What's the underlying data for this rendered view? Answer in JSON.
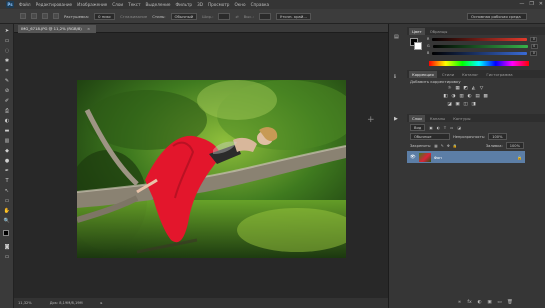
{
  "app": {
    "logo": "Ps"
  },
  "menu": {
    "items": [
      "Файл",
      "Редактирование",
      "Изображение",
      "Слои",
      "Текст",
      "Выделение",
      "Фильтр",
      "3D",
      "Просмотр",
      "Окно",
      "Справка"
    ]
  },
  "window_controls": {
    "minimize": "—",
    "restore": "❐",
    "close": "✕"
  },
  "options_bar": {
    "feather_label": "Растушевка:",
    "feather_value": "0 пикс",
    "antialias_label": "Сглаживание",
    "style_label": "Стиль:",
    "style_value": "Обычный",
    "width_label": "Шир.:",
    "height_label": "Выс.:",
    "refine_label": "Уточн. край...",
    "workspace_value": "Основная рабочая среда"
  },
  "document": {
    "tab_title": "IMG_6718.JPG @ 11,2% (RGB/8)",
    "close_glyph": "×",
    "zoom": "11,32%",
    "doc_info": "Док: 8,19M/8,19M",
    "crosshair_glyph": "+"
  },
  "color_panel": {
    "tabs": [
      "Цвет",
      "Образцы"
    ],
    "labels": [
      "R",
      "G",
      "B"
    ],
    "values": [
      "0",
      "0",
      "0"
    ],
    "colors": {
      "r": "#e33a2c",
      "g": "#36b24a",
      "b": "#3a6bd6"
    }
  },
  "adjustments_panel": {
    "tabs": [
      "Коррекция",
      "Стили",
      "Каталог",
      "Гистограмма"
    ],
    "title": "Добавить корректировку",
    "row1_icons": [
      "☼",
      "▦",
      "◩",
      "◭",
      "▽"
    ],
    "row2_icons": [
      "◧",
      "◑",
      "▥",
      "◐",
      "▤",
      "▩"
    ],
    "row3_icons": [
      "◪",
      "▣",
      "◫",
      "◨"
    ]
  },
  "layers_panel": {
    "tabs": [
      "Слои",
      "Каналы",
      "Контуры"
    ],
    "kind_label": "Вид",
    "blend_mode": "Обычные",
    "opacity_label": "Непрозрачность:",
    "opacity_value": "100%",
    "lock_label": "Закрепить:",
    "fill_label": "Заливка:",
    "fill_value": "100%",
    "layers": [
      {
        "name": "Фон",
        "visible": true,
        "locked": true
      }
    ],
    "bottom_icons": [
      "∞",
      "fx",
      "◐",
      "▣",
      "▭",
      "🗑"
    ]
  },
  "tools": [
    "➤",
    "▭",
    "◌",
    "✱",
    "⌗",
    "✎",
    "⊘",
    "✐",
    "⎙",
    "◐",
    "▬",
    "✒",
    "T",
    "↖",
    "▭",
    "✋",
    "🔍"
  ]
}
